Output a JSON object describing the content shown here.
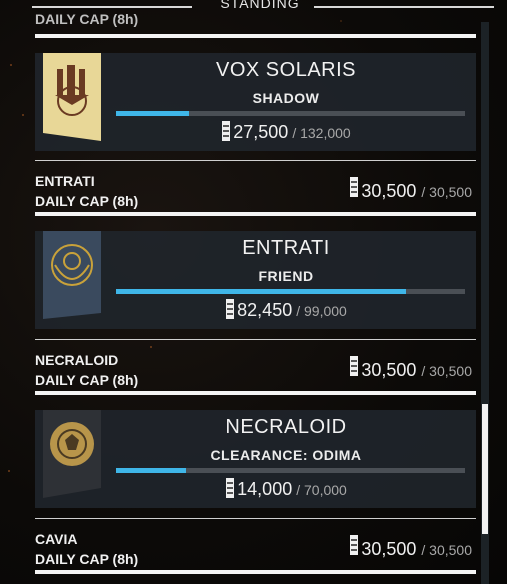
{
  "header": {
    "title": "STANDING"
  },
  "top_cap": {
    "label": "DAILY CAP (8h)"
  },
  "factions": [
    {
      "name": "VOX SOLARIS",
      "rank": "SHADOW",
      "current": "27,500",
      "max": "/ 132,000",
      "progress": 0.21
    },
    {
      "name": "ENTRATI",
      "rank": "FRIEND",
      "current": "82,450",
      "max": "/ 99,000",
      "progress": 0.83
    },
    {
      "name": "NECRALOID",
      "rank": "CLEARANCE: ODIMA",
      "current": "14,000",
      "max": "/ 70,000",
      "progress": 0.2
    }
  ],
  "caps": [
    {
      "line1": "ENTRATI",
      "line2": "DAILY CAP (8h)",
      "current": "30,500",
      "max": "/ 30,500"
    },
    {
      "line1": "NECRALOID",
      "line2": "DAILY CAP (8h)",
      "current": "30,500",
      "max": "/ 30,500"
    },
    {
      "line1": "CAVIA",
      "line2": "DAILY CAP (8h)",
      "current": "30,500",
      "max": "/ 30,500"
    }
  ],
  "colors": {
    "progress": "#3fb6e8",
    "track": "#4a4f55",
    "panel": "#20262c",
    "vox_banner": "#e9d89a",
    "entrati_banner": "#3a4a5e",
    "necraloid_banner": "#2e3136"
  }
}
